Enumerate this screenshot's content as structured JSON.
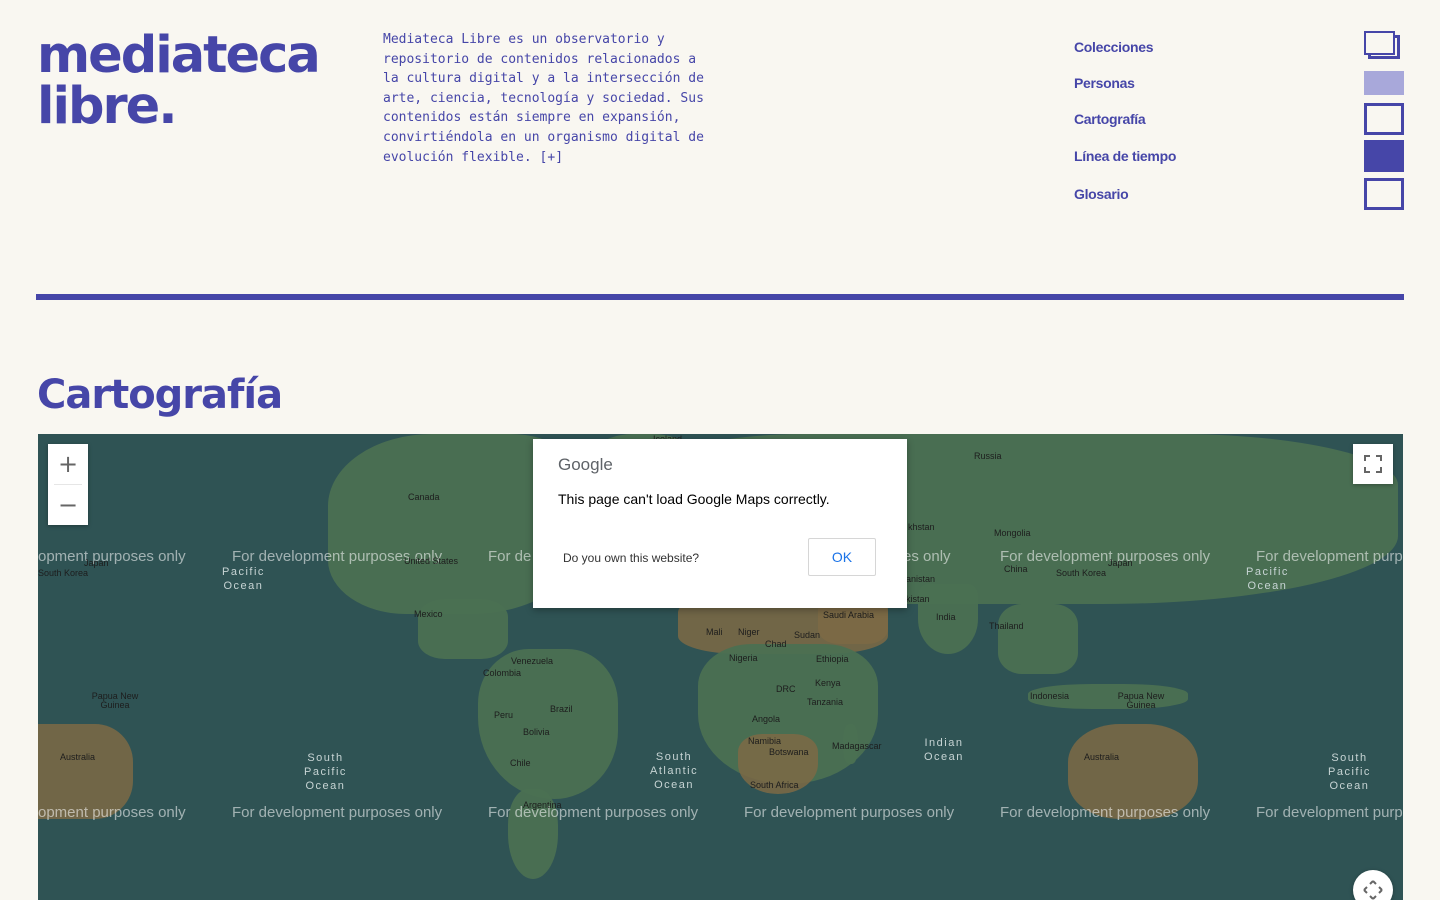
{
  "brand": {
    "line1": "mediateca",
    "line2": "libre."
  },
  "intro": {
    "text": "Mediateca Libre es un observatorio y repositorio de contenidos relacionados a la cultura digital y a la intersección de arte, ciencia, tecnología y sociedad. Sus contenidos están siempre en expansión, convirtiéndola en un organismo digital de evolución flexible.",
    "more": "[+]"
  },
  "nav": {
    "items": [
      {
        "label": "Colecciones",
        "icon": "stacked-squares-icon"
      },
      {
        "label": "Personas",
        "icon": "light-square-icon"
      },
      {
        "label": "Cartografía",
        "icon": "outline-square-icon"
      },
      {
        "label": "Línea de tiempo",
        "icon": "solid-square-icon"
      },
      {
        "label": "Glosario",
        "icon": "outline-square-icon"
      }
    ]
  },
  "section": {
    "title": "Cartografía"
  },
  "map": {
    "watermark": "For development purposes only",
    "watermark_partial_left": "opment purposes only",
    "watermark_partial_right": "For development purp",
    "watermark_partial_mid": "For de",
    "watermark_partial_mid2": "es only",
    "countries": [
      "Russia",
      "Mongolia",
      "China",
      "South Korea",
      "Japan",
      "Canada",
      "United States",
      "Mexico",
      "Venezuela",
      "Colombia",
      "Peru",
      "Brazil",
      "Bolivia",
      "Chile",
      "Argentina",
      "Mali",
      "Niger",
      "Chad",
      "Sudan",
      "Nigeria",
      "Ethiopia",
      "Kenya",
      "DRC",
      "Tanzania",
      "Angola",
      "Namibia",
      "Botswana",
      "South Africa",
      "Madagascar",
      "Saudi Arabia",
      "India",
      "Thailand",
      "Indonesia",
      "Papua New Guinea",
      "Australia"
    ],
    "oceans": {
      "north_pacific": "Pacific\nOcean",
      "south_pacific": "South\nPacific\nOcean",
      "south_atlantic": "South\nAtlantic\nOcean",
      "indian": "Indian\nOcean"
    },
    "partial_labels": {
      "khstan": "khstan",
      "anistan": "anistan",
      "kistan": "kistan",
      "iceland": "Iceland"
    },
    "controls": {
      "zoom_in": "+",
      "zoom_out": "−"
    }
  },
  "dialog": {
    "logo": "Google",
    "message": "This page can't load Google Maps correctly.",
    "link": "Do you own this website?",
    "ok": "OK"
  },
  "colors": {
    "accent": "#4646a8",
    "background": "#f9f7f1",
    "ocean": "#2f5354",
    "link": "#1a73e8"
  }
}
